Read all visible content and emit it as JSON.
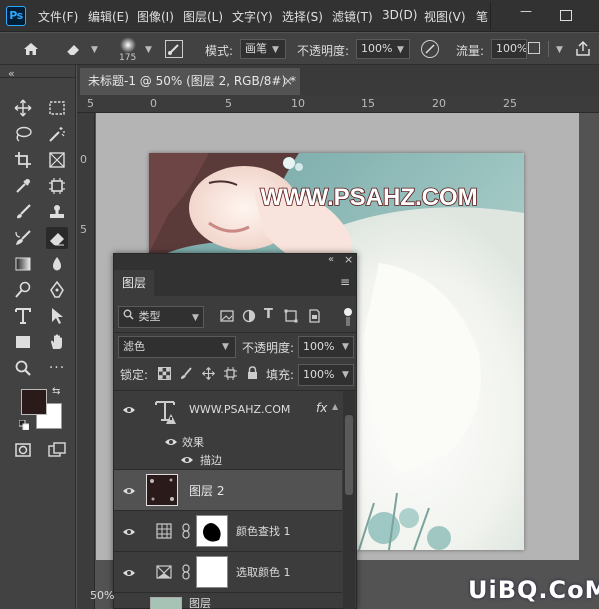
{
  "menubar": {
    "app_logo": "Ps",
    "items": [
      "文件(F)",
      "编辑(E)",
      "图像(I)",
      "图层(L)",
      "文字(Y)",
      "选择(S)",
      "滤镜(T)",
      "3D(D)",
      "视图(V)"
    ],
    "overflow_label": "笔",
    "minimize_label": "—"
  },
  "options": {
    "brush_size": "175",
    "mode_label": "模式:",
    "mode_value": "画笔",
    "opacity_label": "不透明度:",
    "opacity_value": "100%",
    "flow_label": "流量:",
    "flow_value": "100%"
  },
  "dock": {
    "collapse_glyph": "«"
  },
  "document_tab": {
    "title": "未标题-1 @ 50% (图层 2, RGB/8#) *",
    "close_glyph": "×"
  },
  "ruler": {
    "top_labels": [
      "5",
      "0",
      "5",
      "10",
      "15",
      "20",
      "25"
    ],
    "left_labels": [
      "0",
      "5"
    ]
  },
  "canvas": {
    "watermark_text": "WWW.PSAHZ.COM"
  },
  "layers_panel": {
    "collapse_glyph": "«",
    "close_glyph": "×",
    "tab_label": "图层",
    "filter_label": "类型",
    "blend_mode": "滤色",
    "opacity_label": "不透明度:",
    "opacity_value": "100%",
    "lock_label": "锁定:",
    "fill_label": "填充:",
    "fill_value": "100%",
    "layers": [
      {
        "name": "WWW.PSAHZ.COM",
        "kind": "text",
        "fx": "fx"
      },
      {
        "name": "效果",
        "kind": "effects-group"
      },
      {
        "name": "描边",
        "kind": "effect"
      },
      {
        "name": "图层 2",
        "kind": "pixel",
        "selected": true
      },
      {
        "name": "颜色查找 1",
        "kind": "adjustment"
      },
      {
        "name": "选取颜色 1",
        "kind": "adjustment"
      },
      {
        "name": "图层",
        "kind": "pixel"
      }
    ]
  },
  "status": {
    "zoom": "50%"
  },
  "site_watermark": "UiBQ.CoM",
  "colors": {
    "foreground": "#2a1a1a",
    "background": "#ffffff",
    "ps_blue": "#31a8ff"
  }
}
